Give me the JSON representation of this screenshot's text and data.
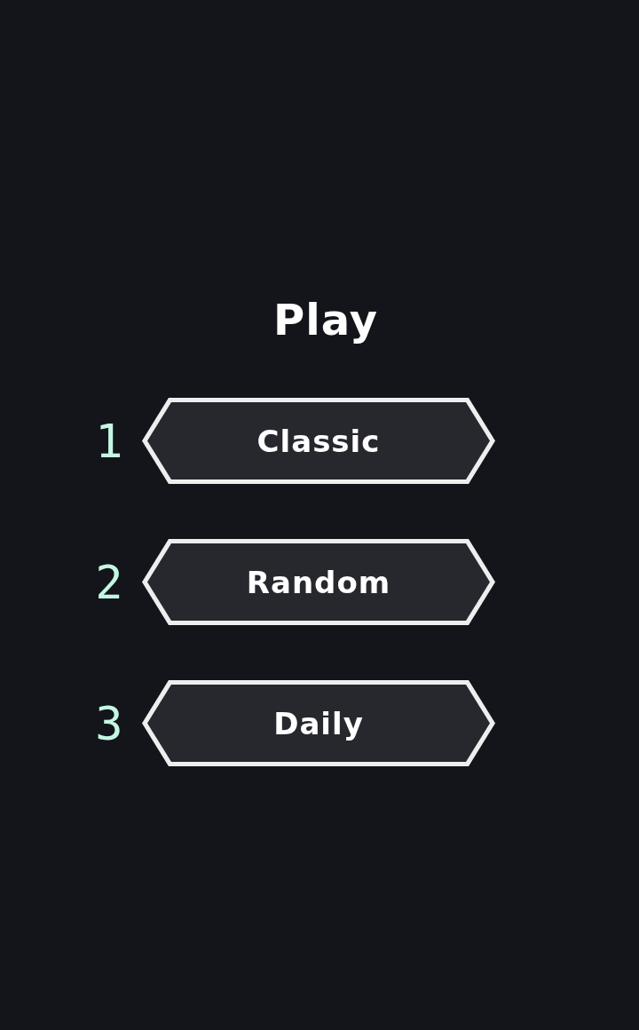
{
  "title": "Play",
  "modes": [
    {
      "shortcut": "1",
      "label": "Classic"
    },
    {
      "shortcut": "2",
      "label": "Random"
    },
    {
      "shortcut": "3",
      "label": "Daily"
    }
  ]
}
